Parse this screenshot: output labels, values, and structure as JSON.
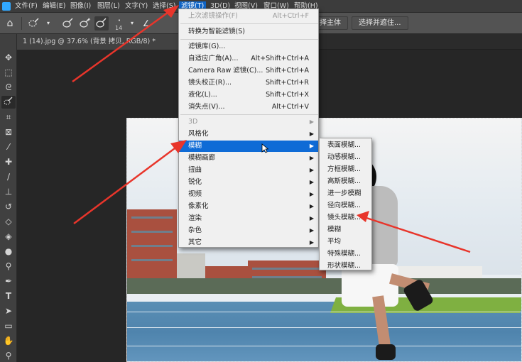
{
  "menubar": {
    "items": [
      "文件(F)",
      "编辑(E)",
      "图像(I)",
      "图层(L)",
      "文字(Y)",
      "选择(S)",
      "滤镜(T)",
      "3D(D)",
      "视图(V)",
      "窗口(W)",
      "帮助(H)"
    ]
  },
  "options_bar": {
    "brush_size": "14",
    "btn_subject": "择主体",
    "btn_select_mask": "选择并遮住..."
  },
  "document_tab": {
    "title": "1 (14).jpg @ 37.6% (背景 拷贝, RGB/8) *"
  },
  "filter_menu": {
    "items": [
      {
        "label": "上次滤镜操作(F)",
        "shortcut": "Alt+Ctrl+F",
        "disabled": true
      },
      {
        "label": "转换为智能滤镜(S)",
        "shortcut": ""
      },
      {
        "label": "滤镜库(G)...",
        "shortcut": ""
      },
      {
        "label": "自适应广角(A)...",
        "shortcut": "Alt+Shift+Ctrl+A"
      },
      {
        "label": "Camera Raw 滤镜(C)...",
        "shortcut": "Shift+Ctrl+A"
      },
      {
        "label": "镜头校正(R)...",
        "shortcut": "Shift+Ctrl+R"
      },
      {
        "label": "液化(L)...",
        "shortcut": "Shift+Ctrl+X"
      },
      {
        "label": "消失点(V)...",
        "shortcut": "Alt+Ctrl+V"
      },
      {
        "label": "3D",
        "submenu": true,
        "disabled": true
      },
      {
        "label": "风格化",
        "submenu": true
      },
      {
        "label": "模糊",
        "submenu": true,
        "highlighted": true
      },
      {
        "label": "模糊画廊",
        "submenu": true
      },
      {
        "label": "扭曲",
        "submenu": true
      },
      {
        "label": "锐化",
        "submenu": true
      },
      {
        "label": "视频",
        "submenu": true
      },
      {
        "label": "像素化",
        "submenu": true
      },
      {
        "label": "渲染",
        "submenu": true
      },
      {
        "label": "杂色",
        "submenu": true
      },
      {
        "label": "其它",
        "submenu": true
      }
    ]
  },
  "blur_submenu": {
    "items": [
      "表面模糊...",
      "动感模糊...",
      "方框模糊...",
      "高斯模糊...",
      "进一步模糊",
      "径向模糊...",
      "镜头模糊...",
      "模糊",
      "平均",
      "特殊模糊...",
      "形状模糊..."
    ]
  },
  "colors": {
    "menu_highlight": "#0f6bd6",
    "annotation_arrow": "#e8352b",
    "panel": "#535353"
  },
  "icons": {
    "home": "home-icon",
    "lasso": "quick-selection-icon"
  }
}
